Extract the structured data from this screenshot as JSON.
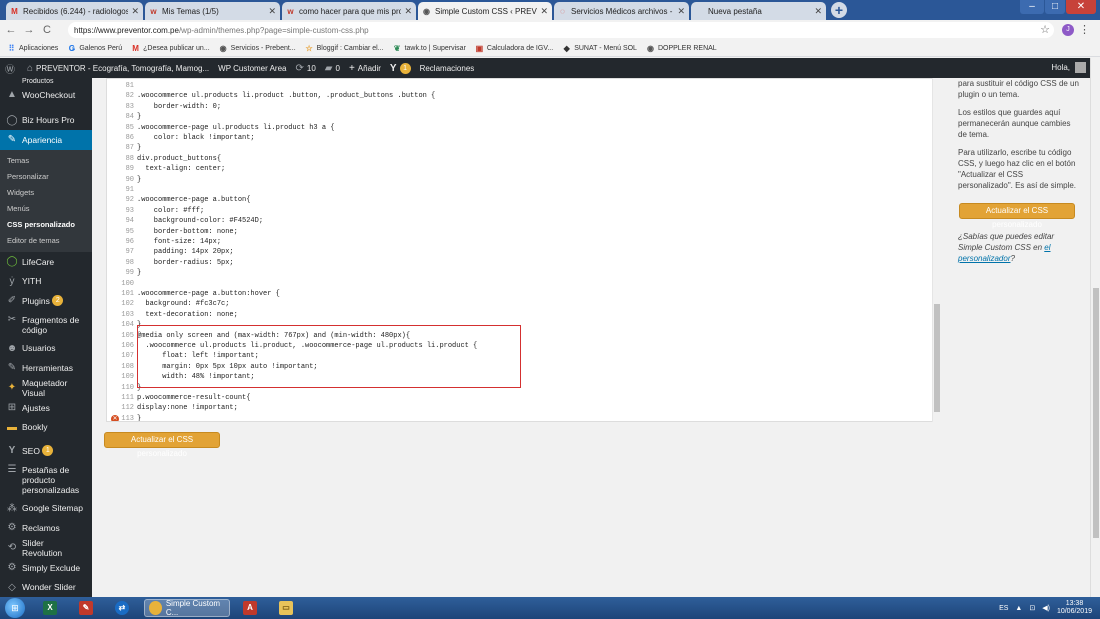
{
  "browser": {
    "tabs": [
      {
        "favicon": "M",
        "favicon_color": "#d93025",
        "title": "Recibidos (6.244) - radiologosen"
      },
      {
        "favicon": "w",
        "favicon_color": "#c0392b",
        "title": "Mis Temas (1/5)"
      },
      {
        "favicon": "w",
        "favicon_color": "#c0392b",
        "title": "como hacer para que mis produ"
      },
      {
        "favicon": "◉",
        "favicon_color": "#555555",
        "title": "Simple Custom CSS ‹ PREVENTO"
      },
      {
        "favicon": "◌",
        "favicon_color": "#d93025",
        "title": "Servicios Médicos archivos - PRE"
      },
      {
        "favicon": "",
        "favicon_color": "#555555",
        "title": "Nueva pestaña"
      }
    ],
    "close_glyph": "✕",
    "new_tab_glyph": "+",
    "window_controls": {
      "minimize": "–",
      "maximize": "□",
      "close": "✕"
    },
    "nav": {
      "back": "←",
      "forward": "→",
      "reload": "C"
    },
    "url_host": "https://www.preventor.com.pe",
    "url_path": "/wp-admin/themes.php?page=simple-custom-css.php",
    "star_glyph": "☆",
    "profile_initial": "J",
    "menu_glyph": "⋮",
    "bookmarks": [
      {
        "icon": "⠿",
        "color": "#4285f4",
        "label": "Aplicaciones"
      },
      {
        "icon": "Ǥ",
        "color": "#1a73e8",
        "label": "Galenos Perú"
      },
      {
        "icon": "M",
        "color": "#d93025",
        "label": "¿Desea publicar un..."
      },
      {
        "icon": "◉",
        "color": "#555555",
        "label": "Servicios - Prebent..."
      },
      {
        "icon": "☆",
        "color": "#e8a33a",
        "label": "Bloggif : Cambiar el..."
      },
      {
        "icon": "❦",
        "color": "#2e8b57",
        "label": "tawk.to | Supervisar"
      },
      {
        "icon": "▣",
        "color": "#c0392b",
        "label": "Calculadora de IGV..."
      },
      {
        "icon": "◆",
        "color": "#333333",
        "label": "SUNAT - Menú SOL"
      },
      {
        "icon": "◉",
        "color": "#555555",
        "label": "DOPPLER RENAL"
      }
    ]
  },
  "adminbar": {
    "wp_logo": "Ⓦ",
    "site_icon": "⌂",
    "site_name": "PREVENTOR - Ecografía, Tomografía, Mamog...",
    "customer_area": "WP Customer Area",
    "updates_icon": "⟳",
    "updates_count": "10",
    "comments_icon": "▰",
    "comments_count": "0",
    "add_icon": "+",
    "add_label": "Añadir",
    "yoast_icon": "Y",
    "yoast_badge": "1",
    "reclamaciones": "Reclamaciones",
    "howdy": "Hola,"
  },
  "sidebar": {
    "top_cut": "Productos",
    "items": [
      {
        "icon": "▲",
        "label": "WooCheckout"
      },
      {
        "icon": "◯",
        "label": "Biz Hours Pro"
      },
      {
        "icon": "✎",
        "label": "Apariencia"
      }
    ],
    "submenu": [
      "Temas",
      "Personalizar",
      "Widgets",
      "Menús",
      "CSS personalizado",
      "Editor de temas"
    ],
    "items_after": [
      {
        "icon": "◯",
        "label": "LifeCare",
        "badge": ""
      },
      {
        "icon": "ẏ",
        "label": "YITH",
        "badge": ""
      },
      {
        "icon": "✐",
        "label": "Plugins",
        "badge": "2"
      },
      {
        "icon": "✂",
        "label": "Fragmentos de código",
        "badge": ""
      },
      {
        "icon": "☻",
        "label": "Usuarios",
        "badge": ""
      },
      {
        "icon": "✎",
        "label": "Herramientas",
        "badge": ""
      },
      {
        "icon": "✦",
        "label": "Maquetador Visual",
        "badge": ""
      },
      {
        "icon": "⊞",
        "label": "Ajustes",
        "badge": ""
      },
      {
        "icon": "▬",
        "label": "Bookly",
        "badge": ""
      },
      {
        "icon": "Y",
        "label": "SEO",
        "badge": "1"
      },
      {
        "icon": "☰",
        "label": "Pestañas de producto personalizadas",
        "badge": ""
      },
      {
        "icon": "⁂",
        "label": "Google Sitemap",
        "badge": ""
      },
      {
        "icon": "⚙",
        "label": "Reclamos",
        "badge": ""
      },
      {
        "icon": "⟲",
        "label": "Slider Revolution",
        "badge": ""
      },
      {
        "icon": "⚙",
        "label": "Simply Exclude",
        "badge": ""
      },
      {
        "icon": "◇",
        "label": "Wonder Slider",
        "badge": ""
      }
    ]
  },
  "editor": {
    "lines": [
      {
        "n": "81",
        "code": ""
      },
      {
        "n": "82",
        "code": ".woocommerce ul.products li.product .button, .product_buttons .button {"
      },
      {
        "n": "83",
        "code": "    border-width: 0;"
      },
      {
        "n": "84",
        "code": "}"
      },
      {
        "n": "85",
        "code": ".woocommerce-page ul.products li.product h3 a {"
      },
      {
        "n": "86",
        "code": "    color: black !important;"
      },
      {
        "n": "87",
        "code": "}"
      },
      {
        "n": "88",
        "code": "div.product_buttons{"
      },
      {
        "n": "89",
        "code": "  text-align: center;"
      },
      {
        "n": "90",
        "code": "}"
      },
      {
        "n": "91",
        "code": ""
      },
      {
        "n": "92",
        "code": ".woocommerce-page a.button{"
      },
      {
        "n": "93",
        "code": "    color: #fff;"
      },
      {
        "n": "94",
        "code": "    background-color: #F4524D;"
      },
      {
        "n": "95",
        "code": "    border-bottom: none;"
      },
      {
        "n": "96",
        "code": "    font-size: 14px;"
      },
      {
        "n": "97",
        "code": "    padding: 14px 20px;"
      },
      {
        "n": "98",
        "code": "    border-radius: 5px;"
      },
      {
        "n": "99",
        "code": "}"
      },
      {
        "n": "100",
        "code": ""
      },
      {
        "n": "101",
        "code": ".woocommerce-page a.button:hover {"
      },
      {
        "n": "102",
        "code": "  background: #fc3c7c;"
      },
      {
        "n": "103",
        "code": "  text-decoration: none;"
      },
      {
        "n": "104",
        "code": "}"
      },
      {
        "n": "105",
        "code": "@media only screen and (max-width: 767px) and (min-width: 480px){"
      },
      {
        "n": "106",
        "code": "  .woocommerce ul.products li.product, .woocommerce-page ul.products li.product {"
      },
      {
        "n": "107",
        "code": "      float: left !important;"
      },
      {
        "n": "108",
        "code": "      margin: 0px 5px 10px auto !important;"
      },
      {
        "n": "109",
        "code": "      width: 48% !important;"
      },
      {
        "n": "110",
        "code": "}"
      },
      {
        "n": "111",
        "code": "p.woocommerce-result-count{"
      },
      {
        "n": "112",
        "code": "display:none !important;"
      },
      {
        "n": "113",
        "code": "}"
      }
    ],
    "error_line": "113",
    "error_glyph": "✕"
  },
  "save_button_label": "Actualizar el CSS personalizado",
  "right_panel": {
    "p1": "para sustituir el código CSS de un plugin o un tema.",
    "p2": "Los estilos que guardes aquí permanecerán aunque cambies de tema.",
    "p3": "Para utilizarlo, escribe tu código CSS, y luego haz clic en el botón \"Actualizar el CSS personalizado\". Es así de simple.",
    "hint_prefix": "¿Sabías que puedes editar Simple Custom CSS en ",
    "hint_link": "el personalizador",
    "hint_suffix": "?"
  },
  "taskbar": {
    "start_glyph": "⊞",
    "apps": [
      {
        "icon": "X",
        "bg": "#1e7145"
      },
      {
        "icon": "✎",
        "bg": "#c0392b"
      },
      {
        "icon": "⇄",
        "bg": "#1a6cc4"
      }
    ],
    "active_title": "Simple Custom C...",
    "extra_apps": [
      {
        "icon": "A",
        "bg": "#c0392b"
      },
      {
        "icon": "▭",
        "bg": "#e8c35a"
      }
    ],
    "lang": "ES",
    "tray_up": "▲",
    "tray_net": "⊡",
    "tray_vol": "◀)",
    "time": "13:38",
    "date": "10/06/2019"
  }
}
